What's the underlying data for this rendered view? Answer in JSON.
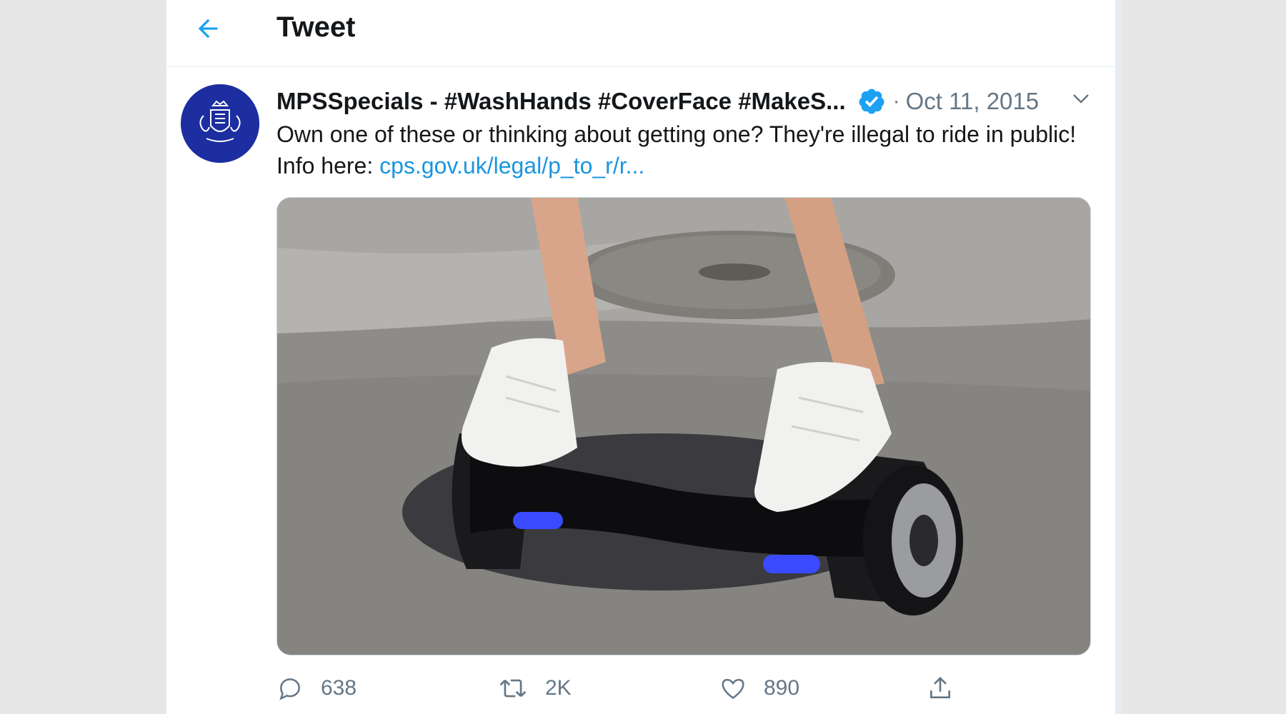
{
  "header": {
    "back_icon": "arrow-left-icon",
    "title": "Tweet"
  },
  "tweet": {
    "author_name": "MPSSpecials - #WashHands #CoverFace #MakeS...",
    "verified_icon": "verified-badge-icon",
    "separator": "·",
    "date": "Oct 11, 2015",
    "more_icon": "chevron-down-icon",
    "text_before_link": "Own one of these or thinking about getting one? They're illegal to ride in public! Info here: ",
    "link_text": "cps.gov.uk/legal/p_to_r/r...",
    "media_icon": "hoverboard-photo"
  },
  "actions": {
    "reply": {
      "icon": "reply-icon",
      "count": "638"
    },
    "retweet": {
      "icon": "retweet-icon",
      "count": "2K"
    },
    "like": {
      "icon": "heart-icon",
      "count": "890"
    },
    "share": {
      "icon": "share-icon"
    }
  },
  "colors": {
    "accent": "#1da1f2",
    "link": "#1b95e0",
    "text": "#14171a",
    "muted": "#657786",
    "avatar_bg": "#1c2ea0"
  }
}
